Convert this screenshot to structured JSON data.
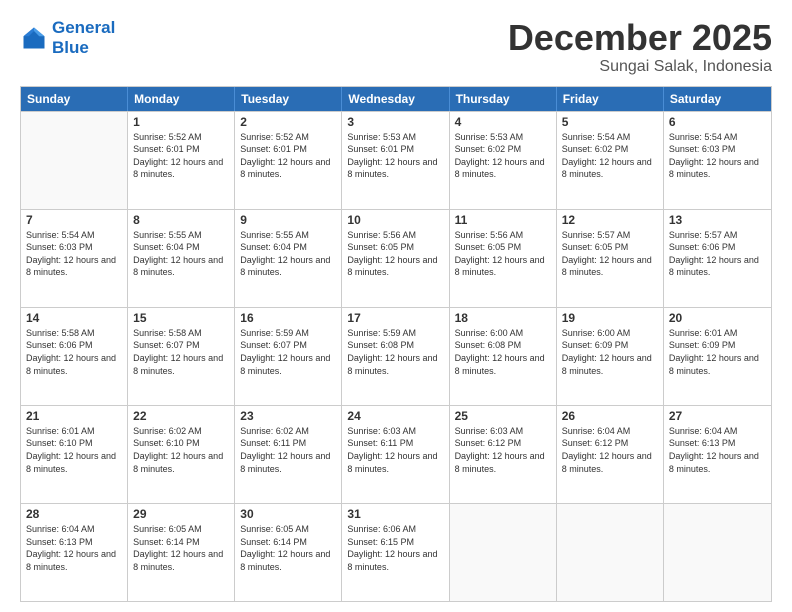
{
  "logo": {
    "line1": "General",
    "line2": "Blue"
  },
  "title": "December 2025",
  "subtitle": "Sungai Salak, Indonesia",
  "header_days": [
    "Sunday",
    "Monday",
    "Tuesday",
    "Wednesday",
    "Thursday",
    "Friday",
    "Saturday"
  ],
  "weeks": [
    [
      {
        "day": "",
        "sunrise": "",
        "sunset": "",
        "daylight": ""
      },
      {
        "day": "1",
        "sunrise": "Sunrise: 5:52 AM",
        "sunset": "Sunset: 6:01 PM",
        "daylight": "Daylight: 12 hours and 8 minutes."
      },
      {
        "day": "2",
        "sunrise": "Sunrise: 5:52 AM",
        "sunset": "Sunset: 6:01 PM",
        "daylight": "Daylight: 12 hours and 8 minutes."
      },
      {
        "day": "3",
        "sunrise": "Sunrise: 5:53 AM",
        "sunset": "Sunset: 6:01 PM",
        "daylight": "Daylight: 12 hours and 8 minutes."
      },
      {
        "day": "4",
        "sunrise": "Sunrise: 5:53 AM",
        "sunset": "Sunset: 6:02 PM",
        "daylight": "Daylight: 12 hours and 8 minutes."
      },
      {
        "day": "5",
        "sunrise": "Sunrise: 5:54 AM",
        "sunset": "Sunset: 6:02 PM",
        "daylight": "Daylight: 12 hours and 8 minutes."
      },
      {
        "day": "6",
        "sunrise": "Sunrise: 5:54 AM",
        "sunset": "Sunset: 6:03 PM",
        "daylight": "Daylight: 12 hours and 8 minutes."
      }
    ],
    [
      {
        "day": "7",
        "sunrise": "Sunrise: 5:54 AM",
        "sunset": "Sunset: 6:03 PM",
        "daylight": "Daylight: 12 hours and 8 minutes."
      },
      {
        "day": "8",
        "sunrise": "Sunrise: 5:55 AM",
        "sunset": "Sunset: 6:04 PM",
        "daylight": "Daylight: 12 hours and 8 minutes."
      },
      {
        "day": "9",
        "sunrise": "Sunrise: 5:55 AM",
        "sunset": "Sunset: 6:04 PM",
        "daylight": "Daylight: 12 hours and 8 minutes."
      },
      {
        "day": "10",
        "sunrise": "Sunrise: 5:56 AM",
        "sunset": "Sunset: 6:05 PM",
        "daylight": "Daylight: 12 hours and 8 minutes."
      },
      {
        "day": "11",
        "sunrise": "Sunrise: 5:56 AM",
        "sunset": "Sunset: 6:05 PM",
        "daylight": "Daylight: 12 hours and 8 minutes."
      },
      {
        "day": "12",
        "sunrise": "Sunrise: 5:57 AM",
        "sunset": "Sunset: 6:05 PM",
        "daylight": "Daylight: 12 hours and 8 minutes."
      },
      {
        "day": "13",
        "sunrise": "Sunrise: 5:57 AM",
        "sunset": "Sunset: 6:06 PM",
        "daylight": "Daylight: 12 hours and 8 minutes."
      }
    ],
    [
      {
        "day": "14",
        "sunrise": "Sunrise: 5:58 AM",
        "sunset": "Sunset: 6:06 PM",
        "daylight": "Daylight: 12 hours and 8 minutes."
      },
      {
        "day": "15",
        "sunrise": "Sunrise: 5:58 AM",
        "sunset": "Sunset: 6:07 PM",
        "daylight": "Daylight: 12 hours and 8 minutes."
      },
      {
        "day": "16",
        "sunrise": "Sunrise: 5:59 AM",
        "sunset": "Sunset: 6:07 PM",
        "daylight": "Daylight: 12 hours and 8 minutes."
      },
      {
        "day": "17",
        "sunrise": "Sunrise: 5:59 AM",
        "sunset": "Sunset: 6:08 PM",
        "daylight": "Daylight: 12 hours and 8 minutes."
      },
      {
        "day": "18",
        "sunrise": "Sunrise: 6:00 AM",
        "sunset": "Sunset: 6:08 PM",
        "daylight": "Daylight: 12 hours and 8 minutes."
      },
      {
        "day": "19",
        "sunrise": "Sunrise: 6:00 AM",
        "sunset": "Sunset: 6:09 PM",
        "daylight": "Daylight: 12 hours and 8 minutes."
      },
      {
        "day": "20",
        "sunrise": "Sunrise: 6:01 AM",
        "sunset": "Sunset: 6:09 PM",
        "daylight": "Daylight: 12 hours and 8 minutes."
      }
    ],
    [
      {
        "day": "21",
        "sunrise": "Sunrise: 6:01 AM",
        "sunset": "Sunset: 6:10 PM",
        "daylight": "Daylight: 12 hours and 8 minutes."
      },
      {
        "day": "22",
        "sunrise": "Sunrise: 6:02 AM",
        "sunset": "Sunset: 6:10 PM",
        "daylight": "Daylight: 12 hours and 8 minutes."
      },
      {
        "day": "23",
        "sunrise": "Sunrise: 6:02 AM",
        "sunset": "Sunset: 6:11 PM",
        "daylight": "Daylight: 12 hours and 8 minutes."
      },
      {
        "day": "24",
        "sunrise": "Sunrise: 6:03 AM",
        "sunset": "Sunset: 6:11 PM",
        "daylight": "Daylight: 12 hours and 8 minutes."
      },
      {
        "day": "25",
        "sunrise": "Sunrise: 6:03 AM",
        "sunset": "Sunset: 6:12 PM",
        "daylight": "Daylight: 12 hours and 8 minutes."
      },
      {
        "day": "26",
        "sunrise": "Sunrise: 6:04 AM",
        "sunset": "Sunset: 6:12 PM",
        "daylight": "Daylight: 12 hours and 8 minutes."
      },
      {
        "day": "27",
        "sunrise": "Sunrise: 6:04 AM",
        "sunset": "Sunset: 6:13 PM",
        "daylight": "Daylight: 12 hours and 8 minutes."
      }
    ],
    [
      {
        "day": "28",
        "sunrise": "Sunrise: 6:04 AM",
        "sunset": "Sunset: 6:13 PM",
        "daylight": "Daylight: 12 hours and 8 minutes."
      },
      {
        "day": "29",
        "sunrise": "Sunrise: 6:05 AM",
        "sunset": "Sunset: 6:14 PM",
        "daylight": "Daylight: 12 hours and 8 minutes."
      },
      {
        "day": "30",
        "sunrise": "Sunrise: 6:05 AM",
        "sunset": "Sunset: 6:14 PM",
        "daylight": "Daylight: 12 hours and 8 minutes."
      },
      {
        "day": "31",
        "sunrise": "Sunrise: 6:06 AM",
        "sunset": "Sunset: 6:15 PM",
        "daylight": "Daylight: 12 hours and 8 minutes."
      },
      {
        "day": "",
        "sunrise": "",
        "sunset": "",
        "daylight": ""
      },
      {
        "day": "",
        "sunrise": "",
        "sunset": "",
        "daylight": ""
      },
      {
        "day": "",
        "sunrise": "",
        "sunset": "",
        "daylight": ""
      }
    ]
  ]
}
